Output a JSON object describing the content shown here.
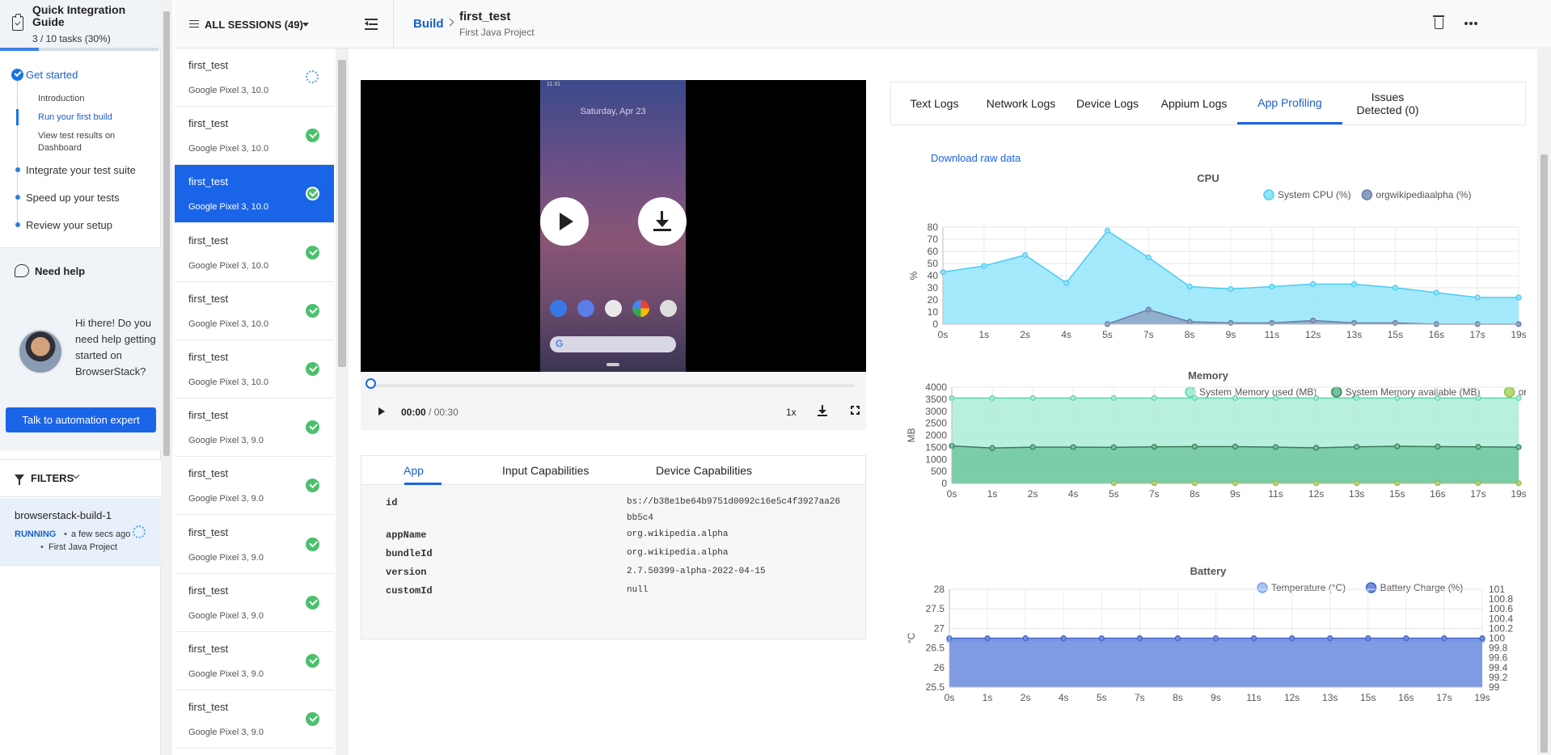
{
  "guide": {
    "title": "Quick Integration Guide",
    "progress_text": "3 / 10 tasks (30%)",
    "progress": 0.3,
    "steps": {
      "get_started": "Get started",
      "introduction": "Introduction",
      "run_first_build": "Run your first build",
      "view_results": "View test results on Dashboard",
      "integrate": "Integrate your test suite",
      "speed_up": "Speed up your tests",
      "review": "Review your setup"
    }
  },
  "help": {
    "title": "Need help",
    "text": "Hi there! Do you need help getting started on BrowserStack?",
    "button": "Talk to automation expert"
  },
  "filters": {
    "label": "FILTERS"
  },
  "build_card": {
    "name": "browserstack-build-1",
    "status": "RUNNING",
    "time": "a few secs ago",
    "project": "First Java Project"
  },
  "sessions": {
    "header": "ALL SESSIONS (49)",
    "items": [
      {
        "name": "first_test",
        "device": "Google Pixel 3, 10.0",
        "state": "running"
      },
      {
        "name": "first_test",
        "device": "Google Pixel 3, 10.0",
        "state": "passed"
      },
      {
        "name": "first_test",
        "device": "Google Pixel 3, 10.0",
        "state": "passed",
        "selected": true
      },
      {
        "name": "first_test",
        "device": "Google Pixel 3, 10.0",
        "state": "passed"
      },
      {
        "name": "first_test",
        "device": "Google Pixel 3, 10.0",
        "state": "passed"
      },
      {
        "name": "first_test",
        "device": "Google Pixel 3, 10.0",
        "state": "passed"
      },
      {
        "name": "first_test",
        "device": "Google Pixel 3, 9.0",
        "state": "passed"
      },
      {
        "name": "first_test",
        "device": "Google Pixel 3, 9.0",
        "state": "passed"
      },
      {
        "name": "first_test",
        "device": "Google Pixel 3, 9.0",
        "state": "passed"
      },
      {
        "name": "first_test",
        "device": "Google Pixel 3, 9.0",
        "state": "passed"
      },
      {
        "name": "first_test",
        "device": "Google Pixel 3, 9.0",
        "state": "passed"
      },
      {
        "name": "first_test",
        "device": "Google Pixel 3, 9.0",
        "state": "passed"
      }
    ]
  },
  "header": {
    "breadcrumb_build": "Build",
    "title": "first_test",
    "subtitle": "First Java Project"
  },
  "video": {
    "phone_date": "Saturday, Apr 23",
    "phone_status": "11:31",
    "time_current": "00:00",
    "time_total": "/ 00:30",
    "speed": "1x"
  },
  "caps": {
    "tabs": [
      "App",
      "Input Capabilities",
      "Device Capabilities"
    ],
    "rows": [
      {
        "key": "id",
        "value": "bs://b38e1be64b9751d0092c16e5c4f3927aa26bb5c4"
      },
      {
        "key": "appName",
        "value": "org.wikipedia.alpha"
      },
      {
        "key": "bundleId",
        "value": "org.wikipedia.alpha"
      },
      {
        "key": "version",
        "value": "2.7.50399-alpha-2022-04-15"
      },
      {
        "key": "customId",
        "value": "null"
      }
    ]
  },
  "logs": {
    "tabs": [
      "Text Logs",
      "Network Logs",
      "Device Logs",
      "Appium Logs",
      "App Profiling",
      "Issues Detected (0)"
    ],
    "active": "App Profiling"
  },
  "profiling": {
    "download_link": "Download raw data"
  },
  "colors": {
    "accent": "#1a64e8",
    "success": "#4cc06c",
    "cpu_fill": "#8fe4fb",
    "mem_used_fill": "#a7ecd4",
    "mem_avail_fill": "#6cc39c",
    "battery_fill": "#6f8fe0"
  },
  "chart_data": [
    {
      "type": "area",
      "title": "CPU",
      "x": [
        "0s",
        "1s",
        "2s",
        "4s",
        "5s",
        "7s",
        "8s",
        "9s",
        "11s",
        "12s",
        "13s",
        "15s",
        "16s",
        "17s",
        "19s"
      ],
      "ylabel": "%",
      "ylim": [
        0,
        80
      ],
      "yticks": [
        0,
        10,
        20,
        30,
        40,
        50,
        60,
        70,
        80
      ],
      "grid": true,
      "legend": "top",
      "series": [
        {
          "name": "System CPU (%)",
          "color": "#48cdf3",
          "fill": "#8fe4fb",
          "values": [
            43,
            48,
            57,
            34,
            77,
            55,
            31,
            29,
            31,
            33,
            33,
            30,
            26,
            22,
            22
          ]
        },
        {
          "name": "orgwikipediaalpha (%)",
          "color": "#6a7ca8",
          "fill": "#8aa0c0",
          "values": [
            null,
            null,
            null,
            null,
            0,
            12,
            2,
            1,
            1,
            3,
            1,
            1,
            0,
            0,
            0
          ]
        }
      ]
    },
    {
      "type": "area",
      "title": "Memory",
      "x": [
        "0s",
        "1s",
        "2s",
        "4s",
        "5s",
        "7s",
        "8s",
        "9s",
        "11s",
        "12s",
        "13s",
        "15s",
        "16s",
        "17s",
        "19s"
      ],
      "ylabel": "MB",
      "ylim": [
        0,
        4000
      ],
      "yticks": [
        0,
        500,
        1000,
        1500,
        2000,
        2500,
        3000,
        3500,
        4000
      ],
      "grid": true,
      "legend": "top",
      "series": [
        {
          "name": "System Memory used (MB)",
          "color": "#5fd6aa",
          "fill": "#a7ecd4",
          "values": [
            3550,
            3550,
            3550,
            3550,
            3550,
            3550,
            3550,
            3550,
            3550,
            3550,
            3550,
            3550,
            3550,
            3550,
            3550
          ]
        },
        {
          "name": "System Memory available (MB)",
          "color": "#3c7a5c",
          "fill": "#6cc39c",
          "values": [
            1560,
            1470,
            1510,
            1510,
            1500,
            1520,
            1530,
            1530,
            1510,
            1480,
            1520,
            1540,
            1530,
            1520,
            1510
          ]
        },
        {
          "name": "orgwikipediaalpha (MB)",
          "color": "#8cbf3c",
          "fill": "#b5d97a",
          "values": [
            null,
            null,
            null,
            null,
            10,
            10,
            10,
            10,
            10,
            10,
            10,
            10,
            10,
            10,
            10
          ]
        }
      ]
    },
    {
      "type": "area",
      "title": "Battery",
      "x": [
        "0s",
        "1s",
        "2s",
        "4s",
        "5s",
        "7s",
        "8s",
        "9s",
        "11s",
        "12s",
        "13s",
        "15s",
        "16s",
        "17s",
        "19s"
      ],
      "ylabel": "°C",
      "ylabel_right": "%",
      "ylim": [
        25.5,
        28.0
      ],
      "yticks": [
        25.5,
        26.0,
        26.5,
        27.0,
        27.5,
        28.0
      ],
      "ylim_right": [
        99.0,
        101.0
      ],
      "yticks_right": [
        99.0,
        99.2,
        99.4,
        99.6,
        99.8,
        100.0,
        100.2,
        100.4,
        100.6,
        100.8,
        101.0
      ],
      "grid": true,
      "legend": "top",
      "series": [
        {
          "name": "Temperature (°C)",
          "color": "#7fa4e8",
          "fill": "#a9c2f0",
          "values": [
            26.7,
            26.7,
            26.7,
            26.7,
            26.7,
            26.7,
            26.7,
            26.7,
            26.7,
            26.7,
            26.7,
            26.7,
            26.7,
            26.7,
            26.7
          ]
        },
        {
          "name": "Battery Charge (%)",
          "color": "#3f62c8",
          "fill": "#6f8fe0",
          "values": [
            100,
            100,
            100,
            100,
            100,
            100,
            100,
            100,
            100,
            100,
            100,
            100,
            100,
            100,
            100
          ]
        }
      ]
    }
  ]
}
